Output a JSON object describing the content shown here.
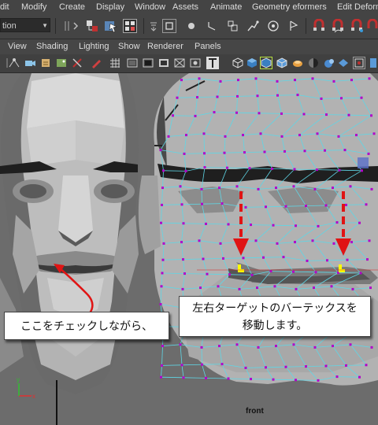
{
  "menubar": {
    "items": [
      "dit",
      "Modify",
      "Create",
      "Display",
      "Window",
      "Assets",
      "Animate",
      "Geometry eformers",
      "Edit Deform"
    ]
  },
  "toolbar": {
    "mode_value": "tion"
  },
  "panel_menu": {
    "items": [
      "View",
      "Shading",
      "Lighting",
      "Show",
      "Renderer",
      "Panels"
    ]
  },
  "annotations": {
    "left_callout": "ここをチェックしながら、",
    "right_callout_line1": "左右ターゲットのバーテックスを",
    "right_callout_line2": "移動します。"
  },
  "viewport": {
    "camera_label": "front",
    "axis_x": "x",
    "axis_y": "y"
  },
  "colors": {
    "wire": "#5fd6e6",
    "vertex": "#b400c8",
    "arrow_red": "#e01414",
    "selected_vertex": "#ffff00"
  }
}
